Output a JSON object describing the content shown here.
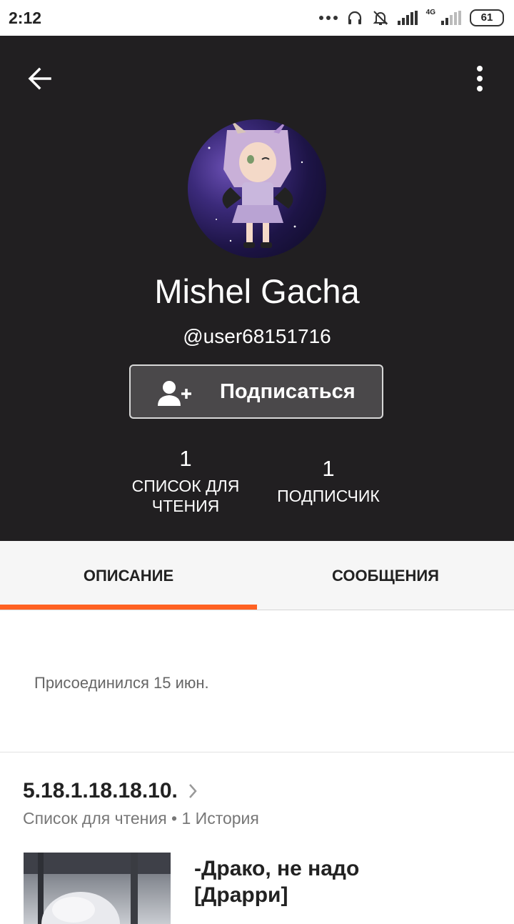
{
  "status_bar": {
    "time": "2:12",
    "network": "4G",
    "battery": "61"
  },
  "profile": {
    "display_name": "Mishel Gacha",
    "username": "@user68151716",
    "follow_label": "Подписаться",
    "stats": [
      {
        "value": "1",
        "label_line1": "СПИСОК ДЛЯ",
        "label_line2": "ЧТЕНИЯ"
      },
      {
        "value": "1",
        "label_line1": "ПОДПИСЧИК",
        "label_line2": ""
      }
    ]
  },
  "tabs": [
    {
      "label": "ОПИСАНИЕ",
      "active": true
    },
    {
      "label": "СООБЩЕНИЯ",
      "active": false
    }
  ],
  "about": {
    "joined": "Присоединился 15 июн."
  },
  "reading_list": {
    "title": "5.18.1.18.18.10.",
    "subtitle": "Список для чтения • 1 История",
    "story_title_line1": "-Драко, не надо",
    "story_title_line2": "[Драрри]"
  },
  "colors": {
    "header_bg": "#211f21",
    "accent": "#ff6122",
    "tab_bg": "#f6f6f6"
  },
  "icons": [
    "back-arrow-icon",
    "more-vertical-icon",
    "add-user-icon",
    "chevron-right-icon",
    "headphones-icon",
    "bell-off-icon",
    "signal-icon",
    "battery-icon"
  ]
}
